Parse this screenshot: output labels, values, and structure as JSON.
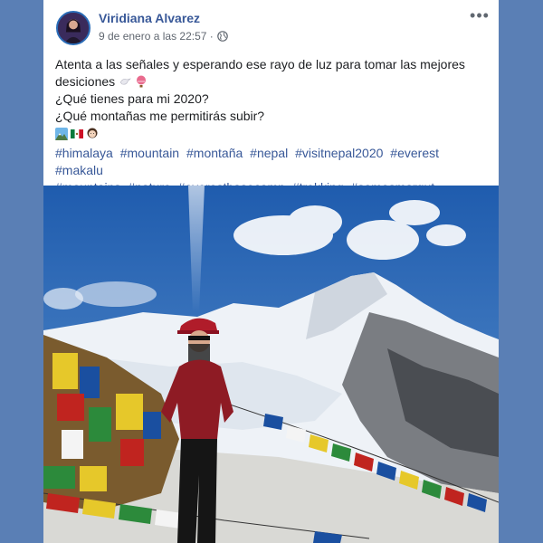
{
  "post": {
    "author": "Viridiana Alvarez",
    "timestamp": "9 de enero a las 22:57 · ",
    "privacy_icon": "globe-icon",
    "more_label": "•••",
    "text_lines": [
      "Atenta a las señales y esperando ese rayo de luz para tomar las mejores desiciones",
      "¿Qué tienes para mi 2020?",
      "¿Qué montañas me permitirás subir?"
    ],
    "text_emojis": [
      "dove-icon",
      "hot-air-balloon-icon"
    ],
    "emoji_line": [
      "mountain-icon",
      "mexico-flag-icon",
      "woman-icon"
    ],
    "hashtags": [
      "#himalaya",
      "#mountain",
      "#montaña",
      "#nepal",
      "#visitnepal2020",
      "#everest",
      "#makalu",
      "#mountains",
      "#nature",
      "#everestbasecamp",
      "#trekking",
      "#somosmargut"
    ]
  },
  "colors": {
    "background": "#5a7fb5",
    "author_link": "#385898",
    "hashtag_link": "#385898",
    "meta_text": "#606770",
    "body_text": "#1c1e21"
  }
}
